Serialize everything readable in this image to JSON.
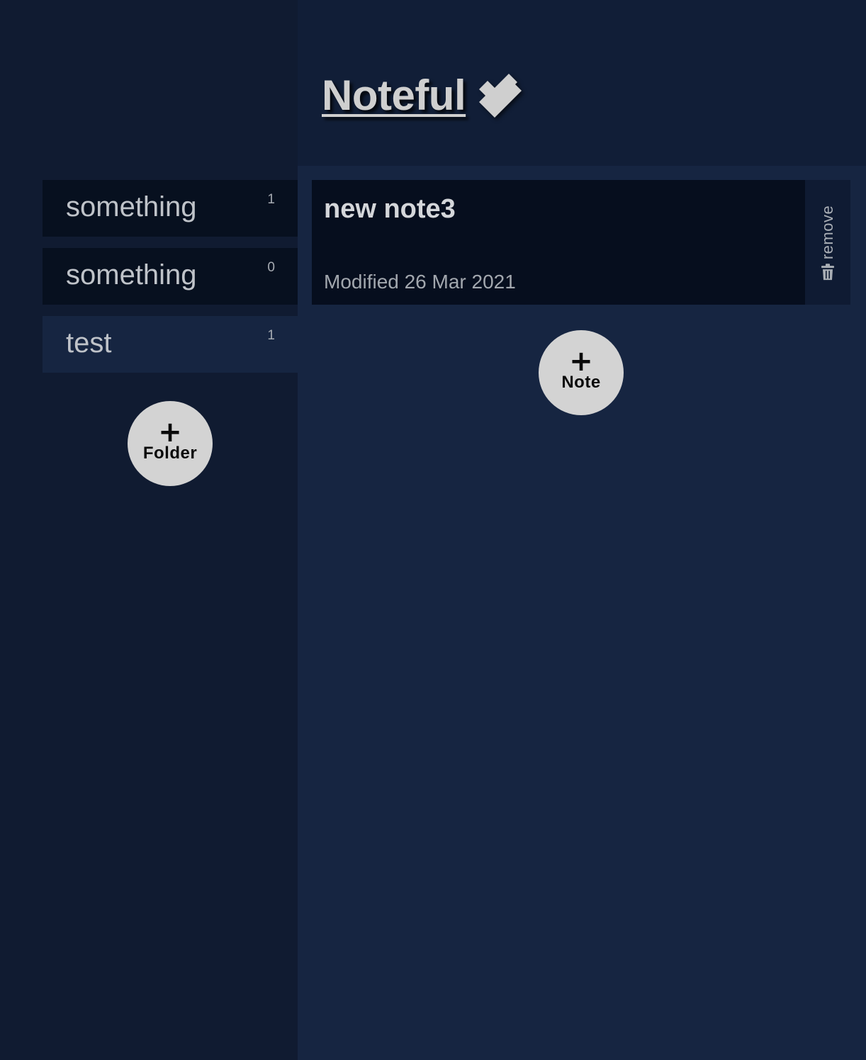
{
  "app": {
    "title": "Noteful",
    "logo_icon": "double-check-icon"
  },
  "sidebar": {
    "folders": [
      {
        "name": "something",
        "count": "1",
        "active": false
      },
      {
        "name": "something",
        "count": "0",
        "active": false
      },
      {
        "name": "test",
        "count": "1",
        "active": true
      }
    ],
    "add_folder_button": {
      "icon": "plus-icon",
      "label": "Folder"
    }
  },
  "main": {
    "notes": [
      {
        "title": "new note3",
        "modified": "Modified 26 Mar 2021",
        "remove_label": "remove",
        "remove_icon": "trash-icon"
      }
    ],
    "add_note_button": {
      "icon": "plus-icon",
      "label": "Note"
    }
  },
  "colors": {
    "sidebar_bg": "#101b31",
    "header_bg": "#111e37",
    "main_bg": "#162541",
    "card_bg": "#060e1e",
    "button_bg": "#d3d3d3",
    "text_light": "#cfcfcf"
  }
}
